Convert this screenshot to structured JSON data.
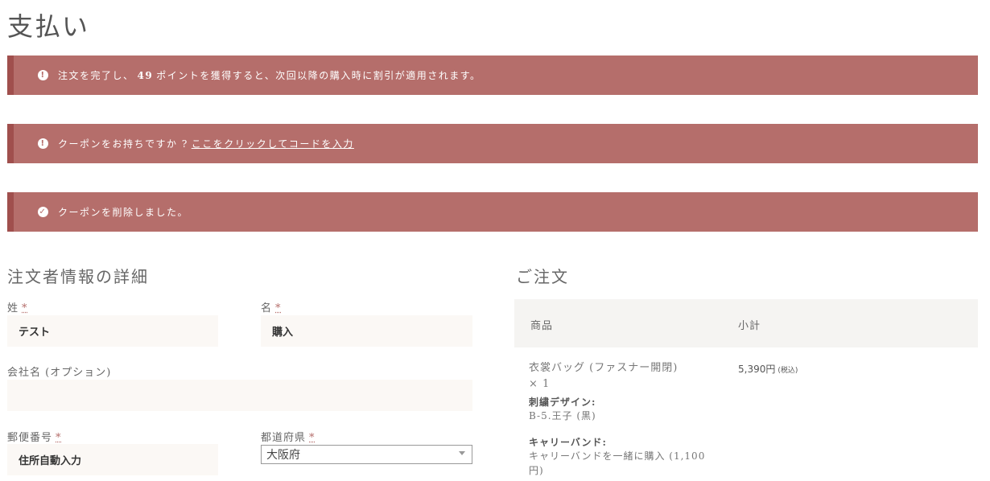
{
  "page": {
    "title": "支払い"
  },
  "notices": {
    "points": {
      "pre": "注文を完了し、",
      "num": "49",
      "post": "ポイントを獲得すると、次回以降の購入時に割引が適用されます。"
    },
    "coupon": {
      "text": "クーポンをお持ちですか ?",
      "link": "ここをクリックしてコードを入力"
    },
    "removed": {
      "text": "クーポンを削除しました。"
    }
  },
  "billing": {
    "title": "注文者情報の詳細",
    "last_name_label": "姓",
    "last_name_value": "テスト",
    "first_name_label": "名",
    "first_name_value": "購入",
    "company_label": "会社名 (オプション)",
    "company_value": "",
    "postcode_label": "郵便番号",
    "postcode_value": "住所自動入力",
    "prefecture_label": "都道府県",
    "prefecture_value": "大阪府",
    "required_mark": "*"
  },
  "order": {
    "title": "ご注文",
    "col_product": "商品",
    "col_subtotal": "小計",
    "item": {
      "name": "衣裳バッグ (ファスナー開閉)",
      "qty": "× 1",
      "meta1_key": "刺繍デザイン:",
      "meta1_value": "B-5.王子 (黒)",
      "meta2_key": "キャリーバンド:",
      "meta2_value_line1": "キャリーバンドを一緒に購入 (1,100",
      "meta2_value_line2": "円)",
      "price": "5,390円",
      "tax_note": "(税込)"
    }
  },
  "colors": {
    "notice_bg": "#b56e6b",
    "notice_border": "#a04f4d",
    "field_bg": "#fbf8f5"
  },
  "icons": {
    "info": "info-circle-icon",
    "check": "check-circle-icon",
    "dropdown": "chevron-down-icon"
  }
}
